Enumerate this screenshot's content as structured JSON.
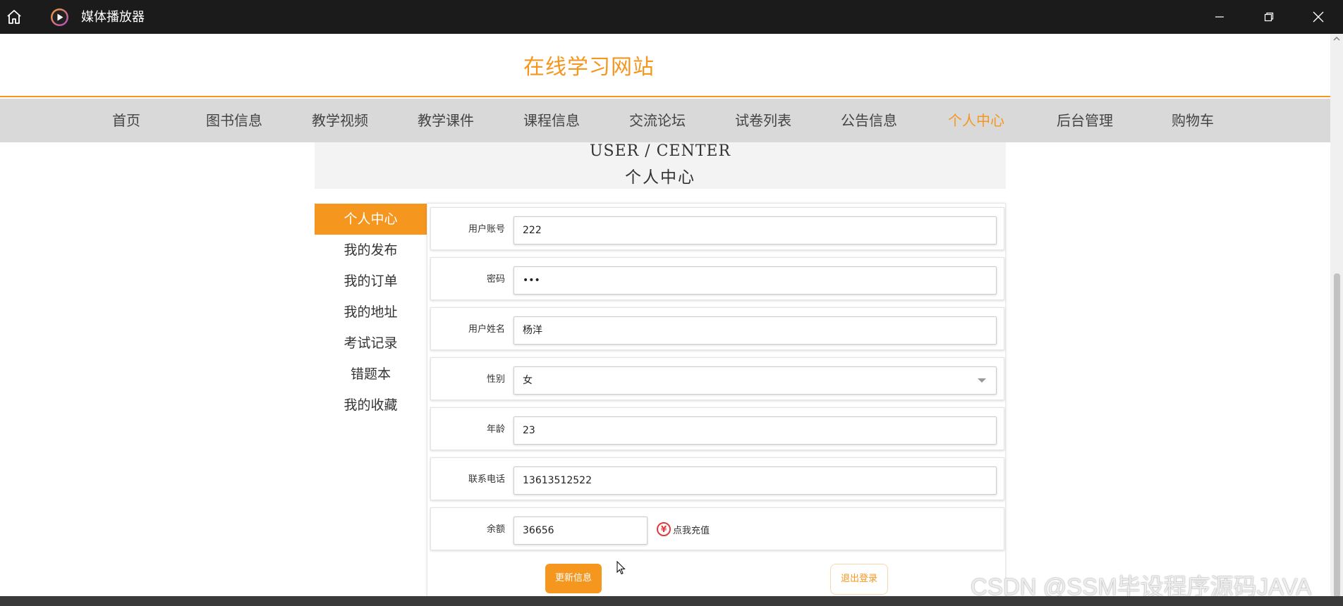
{
  "window": {
    "title": "媒体播放器"
  },
  "site": {
    "title": "在线学习网站"
  },
  "nav": {
    "items": [
      "首页",
      "图书信息",
      "教学视频",
      "教学课件",
      "课程信息",
      "交流论坛",
      "试卷列表",
      "公告信息",
      "个人中心",
      "后台管理",
      "购物车"
    ],
    "active_index": 8
  },
  "section": {
    "title_en": "USER / CENTER",
    "title_cn": "个人中心"
  },
  "sidebar": {
    "items": [
      "个人中心",
      "我的发布",
      "我的订单",
      "我的地址",
      "考试记录",
      "错题本",
      "我的收藏"
    ],
    "active_index": 0
  },
  "form": {
    "account_label": "用户账号",
    "account_value": "222",
    "password_label": "密码",
    "password_value": "•••",
    "name_label": "用户姓名",
    "name_value": "杨洋",
    "gender_label": "性别",
    "gender_value": "女",
    "age_label": "年龄",
    "age_value": "23",
    "phone_label": "联系电话",
    "phone_value": "13613512522",
    "balance_label": "余额",
    "balance_value": "36656",
    "recharge_icon": "¥",
    "recharge_label": "点我充值",
    "update_label": "更新信息",
    "logout_label": "退出登录"
  },
  "watermark": "CSDN @SSM毕设程序源码JAVA",
  "colors": {
    "accent": "#f5961f",
    "nav_bg": "#d9d9d9",
    "titlebar_bg": "#1b1b1b"
  }
}
